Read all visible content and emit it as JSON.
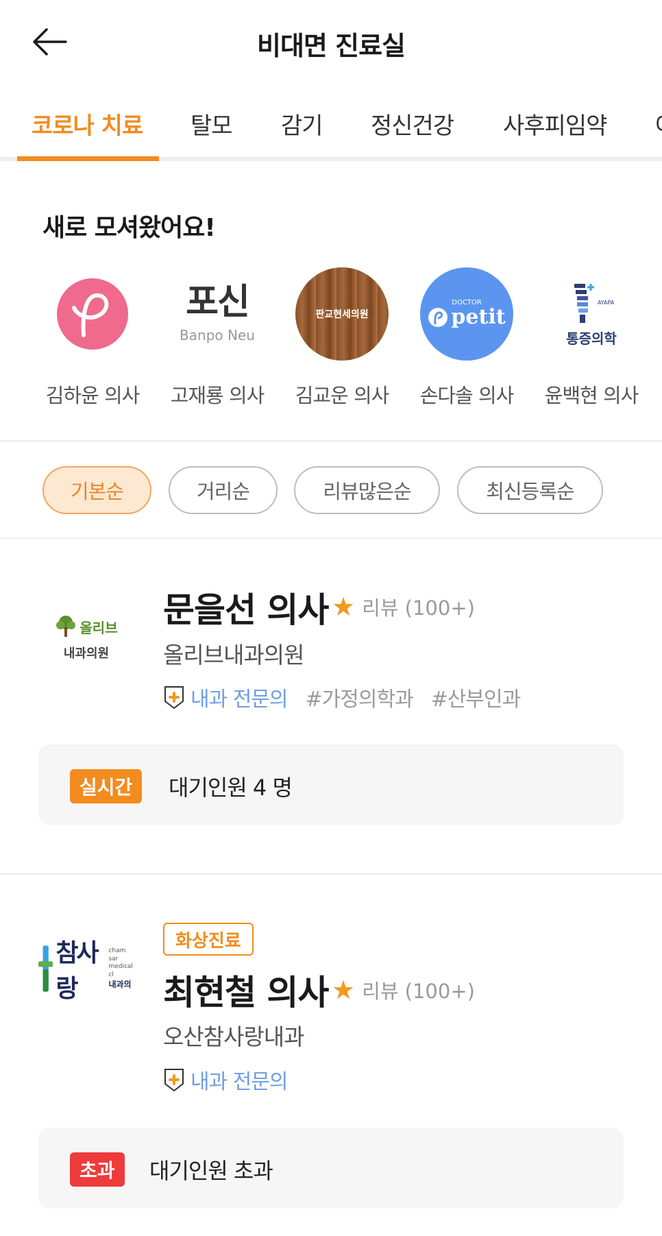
{
  "header": {
    "title": "비대면 진료실"
  },
  "tabs": [
    {
      "label": "코로나 치료",
      "active": true
    },
    {
      "label": "탈모"
    },
    {
      "label": "감기"
    },
    {
      "label": "정신건강"
    },
    {
      "label": "사후피임약"
    },
    {
      "label": "여"
    }
  ],
  "new_section": {
    "title": "새로 모셔왔어요!",
    "doctors": [
      {
        "name": "김하윤 의사",
        "logo_text": ""
      },
      {
        "name": "고재룡 의사",
        "logo_text": "포신",
        "logo_sub": "Banpo Neu"
      },
      {
        "name": "김교운 의사",
        "logo_text": "판교현세의원"
      },
      {
        "name": "손다솔 의사",
        "logo_text": "petit",
        "logo_sub": "DOCTOR"
      },
      {
        "name": "윤백현 의사",
        "logo_text": "통증의학",
        "logo_sub": "AYAPA"
      }
    ]
  },
  "sort": {
    "options": [
      {
        "label": "기본순",
        "active": true
      },
      {
        "label": "거리순"
      },
      {
        "label": "리뷰많은순"
      },
      {
        "label": "최신등록순"
      }
    ]
  },
  "cards": [
    {
      "doctor": "문을선 의사",
      "review": "리뷰 (100+)",
      "clinic": "올리브내과의원",
      "specialty": "내과 전문의",
      "hashtags": [
        "#가정의학과",
        "#산부인과"
      ],
      "logo_line1": "올리브",
      "logo_line2": "내과의원",
      "status_badge": "실시간",
      "status_color": "#f28c1f",
      "status_text": "대기인원 4 명"
    },
    {
      "video_badge": "화상진료",
      "doctor": "최현철 의사",
      "review": "리뷰 (100+)",
      "clinic": "오산참사랑내과",
      "specialty": "내과 전문의",
      "logo_text": "참사랑",
      "logo_sub1": "cham sar",
      "logo_sub2": "medical cl",
      "logo_sub3": "내과의",
      "status_badge": "초과",
      "status_color": "#ee3b3b",
      "status_text": "대기인원 초과"
    }
  ],
  "colors": {
    "accent": "#f28c1f",
    "link_blue": "#6f9fe3",
    "over": "#ee3b3b"
  }
}
